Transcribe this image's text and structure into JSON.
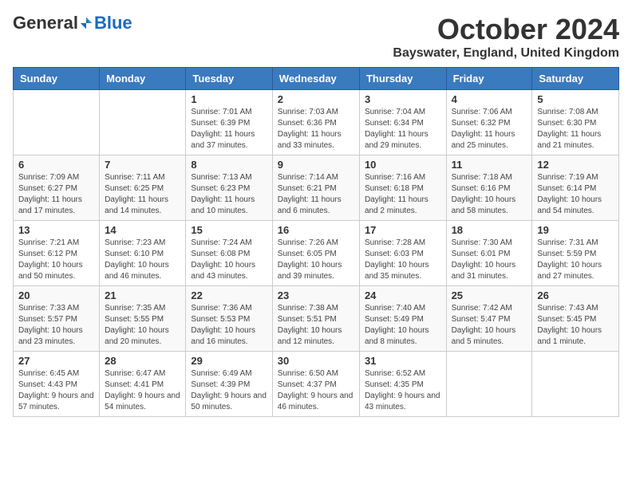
{
  "logo": {
    "general": "General",
    "blue": "Blue"
  },
  "header": {
    "month": "October 2024",
    "location": "Bayswater, England, United Kingdom"
  },
  "days_of_week": [
    "Sunday",
    "Monday",
    "Tuesday",
    "Wednesday",
    "Thursday",
    "Friday",
    "Saturday"
  ],
  "weeks": [
    [
      {
        "day": "",
        "info": ""
      },
      {
        "day": "",
        "info": ""
      },
      {
        "day": "1",
        "info": "Sunrise: 7:01 AM\nSunset: 6:39 PM\nDaylight: 11 hours and 37 minutes."
      },
      {
        "day": "2",
        "info": "Sunrise: 7:03 AM\nSunset: 6:36 PM\nDaylight: 11 hours and 33 minutes."
      },
      {
        "day": "3",
        "info": "Sunrise: 7:04 AM\nSunset: 6:34 PM\nDaylight: 11 hours and 29 minutes."
      },
      {
        "day": "4",
        "info": "Sunrise: 7:06 AM\nSunset: 6:32 PM\nDaylight: 11 hours and 25 minutes."
      },
      {
        "day": "5",
        "info": "Sunrise: 7:08 AM\nSunset: 6:30 PM\nDaylight: 11 hours and 21 minutes."
      }
    ],
    [
      {
        "day": "6",
        "info": "Sunrise: 7:09 AM\nSunset: 6:27 PM\nDaylight: 11 hours and 17 minutes."
      },
      {
        "day": "7",
        "info": "Sunrise: 7:11 AM\nSunset: 6:25 PM\nDaylight: 11 hours and 14 minutes."
      },
      {
        "day": "8",
        "info": "Sunrise: 7:13 AM\nSunset: 6:23 PM\nDaylight: 11 hours and 10 minutes."
      },
      {
        "day": "9",
        "info": "Sunrise: 7:14 AM\nSunset: 6:21 PM\nDaylight: 11 hours and 6 minutes."
      },
      {
        "day": "10",
        "info": "Sunrise: 7:16 AM\nSunset: 6:18 PM\nDaylight: 11 hours and 2 minutes."
      },
      {
        "day": "11",
        "info": "Sunrise: 7:18 AM\nSunset: 6:16 PM\nDaylight: 10 hours and 58 minutes."
      },
      {
        "day": "12",
        "info": "Sunrise: 7:19 AM\nSunset: 6:14 PM\nDaylight: 10 hours and 54 minutes."
      }
    ],
    [
      {
        "day": "13",
        "info": "Sunrise: 7:21 AM\nSunset: 6:12 PM\nDaylight: 10 hours and 50 minutes."
      },
      {
        "day": "14",
        "info": "Sunrise: 7:23 AM\nSunset: 6:10 PM\nDaylight: 10 hours and 46 minutes."
      },
      {
        "day": "15",
        "info": "Sunrise: 7:24 AM\nSunset: 6:08 PM\nDaylight: 10 hours and 43 minutes."
      },
      {
        "day": "16",
        "info": "Sunrise: 7:26 AM\nSunset: 6:05 PM\nDaylight: 10 hours and 39 minutes."
      },
      {
        "day": "17",
        "info": "Sunrise: 7:28 AM\nSunset: 6:03 PM\nDaylight: 10 hours and 35 minutes."
      },
      {
        "day": "18",
        "info": "Sunrise: 7:30 AM\nSunset: 6:01 PM\nDaylight: 10 hours and 31 minutes."
      },
      {
        "day": "19",
        "info": "Sunrise: 7:31 AM\nSunset: 5:59 PM\nDaylight: 10 hours and 27 minutes."
      }
    ],
    [
      {
        "day": "20",
        "info": "Sunrise: 7:33 AM\nSunset: 5:57 PM\nDaylight: 10 hours and 23 minutes."
      },
      {
        "day": "21",
        "info": "Sunrise: 7:35 AM\nSunset: 5:55 PM\nDaylight: 10 hours and 20 minutes."
      },
      {
        "day": "22",
        "info": "Sunrise: 7:36 AM\nSunset: 5:53 PM\nDaylight: 10 hours and 16 minutes."
      },
      {
        "day": "23",
        "info": "Sunrise: 7:38 AM\nSunset: 5:51 PM\nDaylight: 10 hours and 12 minutes."
      },
      {
        "day": "24",
        "info": "Sunrise: 7:40 AM\nSunset: 5:49 PM\nDaylight: 10 hours and 8 minutes."
      },
      {
        "day": "25",
        "info": "Sunrise: 7:42 AM\nSunset: 5:47 PM\nDaylight: 10 hours and 5 minutes."
      },
      {
        "day": "26",
        "info": "Sunrise: 7:43 AM\nSunset: 5:45 PM\nDaylight: 10 hours and 1 minute."
      }
    ],
    [
      {
        "day": "27",
        "info": "Sunrise: 6:45 AM\nSunset: 4:43 PM\nDaylight: 9 hours and 57 minutes."
      },
      {
        "day": "28",
        "info": "Sunrise: 6:47 AM\nSunset: 4:41 PM\nDaylight: 9 hours and 54 minutes."
      },
      {
        "day": "29",
        "info": "Sunrise: 6:49 AM\nSunset: 4:39 PM\nDaylight: 9 hours and 50 minutes."
      },
      {
        "day": "30",
        "info": "Sunrise: 6:50 AM\nSunset: 4:37 PM\nDaylight: 9 hours and 46 minutes."
      },
      {
        "day": "31",
        "info": "Sunrise: 6:52 AM\nSunset: 4:35 PM\nDaylight: 9 hours and 43 minutes."
      },
      {
        "day": "",
        "info": ""
      },
      {
        "day": "",
        "info": ""
      }
    ]
  ]
}
